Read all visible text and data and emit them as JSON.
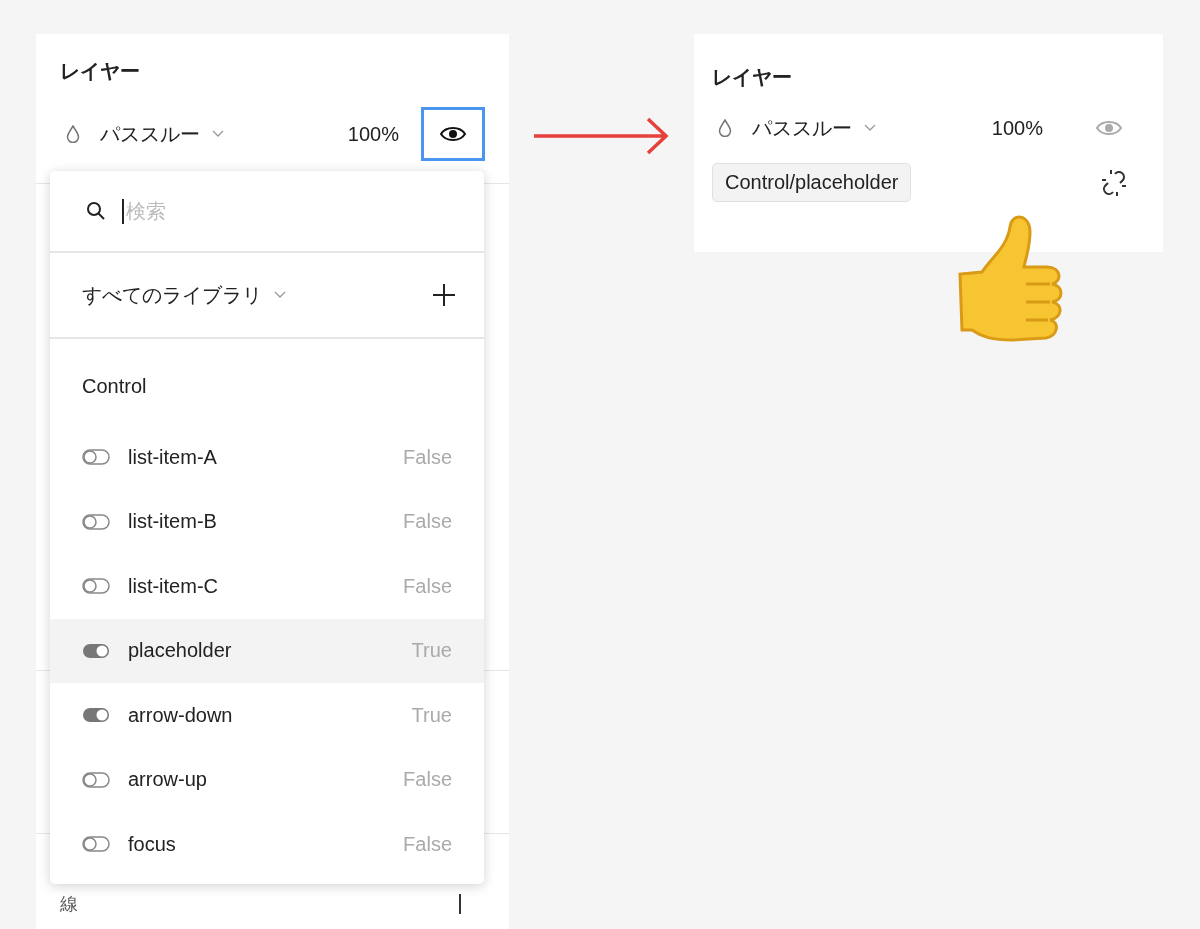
{
  "left_panel": {
    "title": "レイヤー",
    "blend_mode": "パススルー",
    "opacity": "100%",
    "eye_focused": true,
    "section_label": "線"
  },
  "dropdown": {
    "search": {
      "placeholder": "検索"
    },
    "library_filter": "すべてのライブラリ",
    "group_title": "Control",
    "items": [
      {
        "name": "list-item-A",
        "value": "False",
        "on": false,
        "selected": false
      },
      {
        "name": "list-item-B",
        "value": "False",
        "on": false,
        "selected": false
      },
      {
        "name": "list-item-C",
        "value": "False",
        "on": false,
        "selected": false
      },
      {
        "name": "placeholder",
        "value": "True",
        "on": true,
        "selected": true
      },
      {
        "name": "arrow-down",
        "value": "True",
        "on": true,
        "selected": false
      },
      {
        "name": "arrow-up",
        "value": "False",
        "on": false,
        "selected": false
      },
      {
        "name": "focus",
        "value": "False",
        "on": false,
        "selected": false
      }
    ]
  },
  "right_panel": {
    "title": "レイヤー",
    "blend_mode": "パススルー",
    "opacity": "100%",
    "eye_focused": false,
    "component_tag": "Control/placeholder"
  }
}
